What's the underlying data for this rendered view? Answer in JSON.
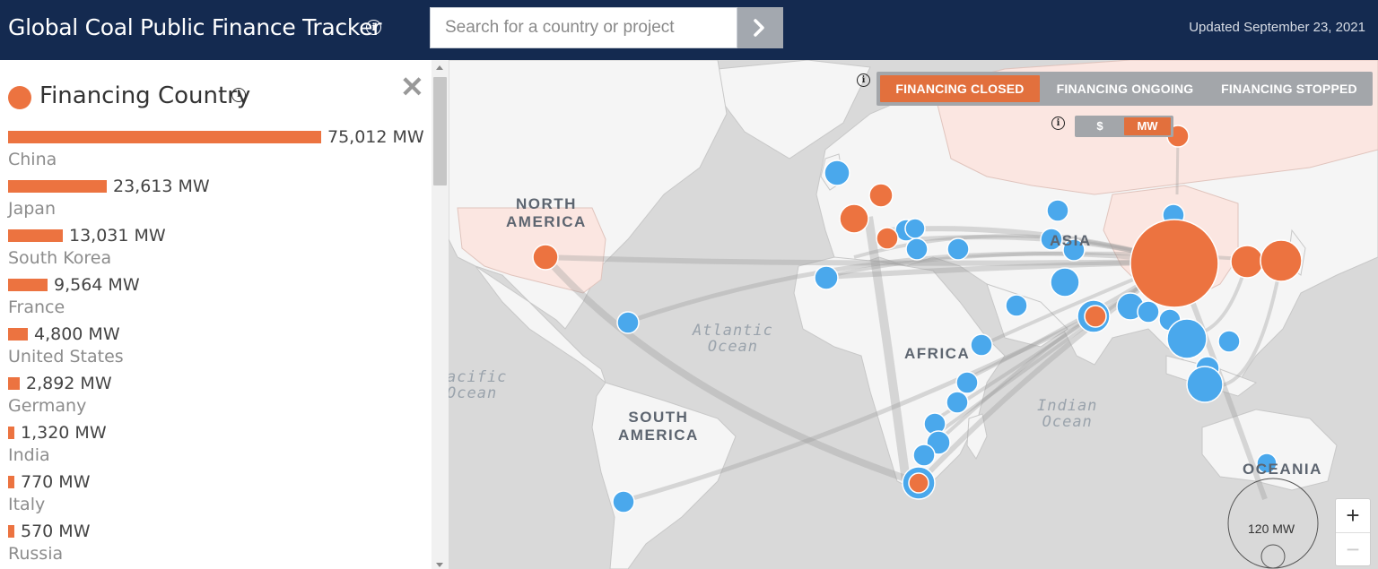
{
  "header": {
    "title": "Global Coal Public Finance Tracker",
    "info_icon": "info-icon",
    "search_placeholder": "Search for a country or project",
    "search_button_icon": "chevron-right-icon",
    "updated": "Updated September 23, 2021"
  },
  "panel": {
    "legend_title": "Financing Country",
    "legend_color": "#ec7340",
    "close_icon": "close-icon",
    "countries": [
      {
        "name": "China",
        "value": "75,012 MW",
        "mw": 75012
      },
      {
        "name": "Japan",
        "value": "23,613 MW",
        "mw": 23613
      },
      {
        "name": "South Korea",
        "value": "13,031 MW",
        "mw": 13031
      },
      {
        "name": "France",
        "value": "9,564 MW",
        "mw": 9564
      },
      {
        "name": "United States",
        "value": "4,800 MW",
        "mw": 4800
      },
      {
        "name": "Germany",
        "value": "2,892 MW",
        "mw": 2892
      },
      {
        "name": "India",
        "value": "1,320 MW",
        "mw": 1320
      },
      {
        "name": "Italy",
        "value": "770 MW",
        "mw": 770
      },
      {
        "name": "Russia",
        "value": "570 MW",
        "mw": 570
      }
    ]
  },
  "map": {
    "status_buttons": [
      {
        "label": "FINANCING CLOSED",
        "active": true
      },
      {
        "label": "FINANCING ONGOING",
        "active": false
      },
      {
        "label": "FINANCING STOPPED",
        "active": false
      }
    ],
    "unit_buttons": [
      {
        "label": "$",
        "active": false
      },
      {
        "label": "MW",
        "active": true
      }
    ],
    "region_labels": {
      "north_america": "NORTH\nAMERICA",
      "south_america": "SOUTH\nAMERICA",
      "africa": "AFRICA",
      "asia": "ASIA",
      "oceania": "OCEANIA"
    },
    "ocean_labels": {
      "atlantic": "Atlantic\nOcean",
      "pacific": "acific\nOcean",
      "indian": "Indian\nOcean"
    },
    "size_legend": "120 MW",
    "zoom_in": "+",
    "zoom_out": "−",
    "colors": {
      "financing_country": "#ec7340",
      "recipient_country": "#4aa8ec",
      "land": "#f4f4f4",
      "ocean": "#d9d9d9"
    }
  }
}
